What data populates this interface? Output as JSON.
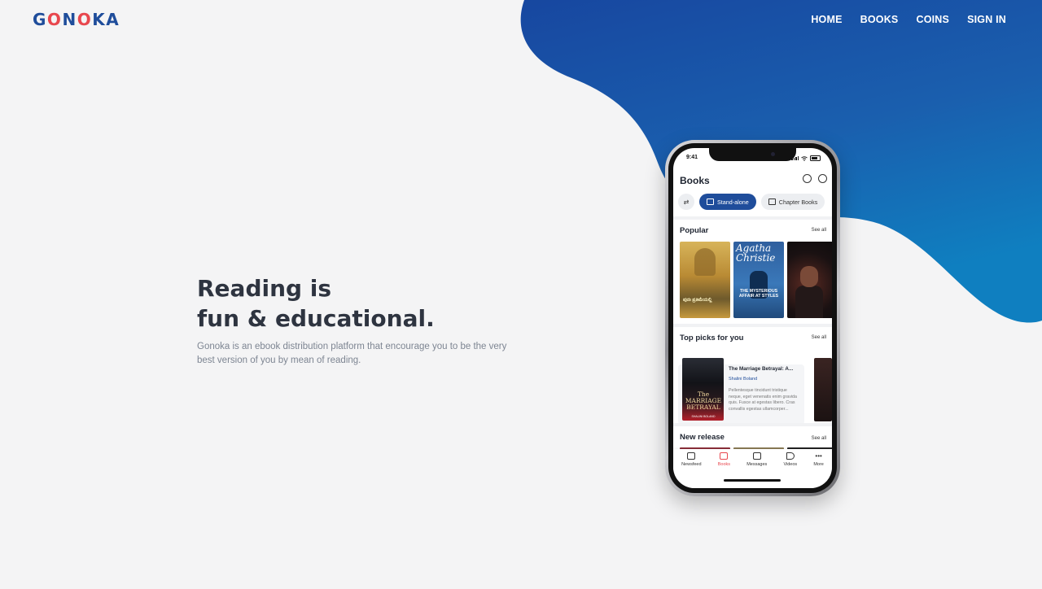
{
  "brand": {
    "logo_left": "G",
    "logo_o1": "O",
    "logo_n": "N",
    "logo_o2": "O",
    "logo_right": "KA"
  },
  "nav": {
    "home": "HOME",
    "books": "BOOKS",
    "coins": "COINS",
    "signin": "SIGN IN"
  },
  "hero": {
    "title_line1": "Reading is",
    "title_line2": "fun & educational.",
    "description": "Gonoka is an ebook distribution platform that encourage you to be the very best version of you by mean of reading."
  },
  "phone": {
    "time": "9:41",
    "app_title": "Books",
    "chips": {
      "standalone": "Stand-alone",
      "chapter": "Chapter Books"
    },
    "popular": {
      "title": "Popular",
      "see_all": "See all"
    },
    "covers": {
      "c1_text": "ಪುನಃ ಪ್ರತಿಮೆಯಲ್ಲಿ",
      "c2_sig": "Agatha Christie",
      "c2_title": "THE MYSTERIOUS AFFAIR AT STYLES"
    },
    "top_picks": {
      "title": "Top picks for you",
      "see_all": "See all",
      "book_title": "The Marriage Betrayal: A...",
      "author": "Shalini Boland",
      "cover_title": "The MARRIAGE BETRAYAL",
      "cover_author": "SHALINI BOLAND",
      "description": "Pellentesque tincidunt tristique neque, eget venenatis enim gravida quis. Fusce at egestas libero. Cras convallis egestas ullamcorper..."
    },
    "new_release": {
      "title": "New release",
      "see_all": "See all"
    },
    "tabs": {
      "newsfeed": "Newsfeed",
      "books": "Books",
      "messages": "Messages",
      "videos": "Videos",
      "more": "More"
    }
  },
  "colors": {
    "brand_blue": "#1f4d9b",
    "brand_red": "#e8474e",
    "blob_start": "#1747a0",
    "blob_end": "#0f7fc0"
  }
}
